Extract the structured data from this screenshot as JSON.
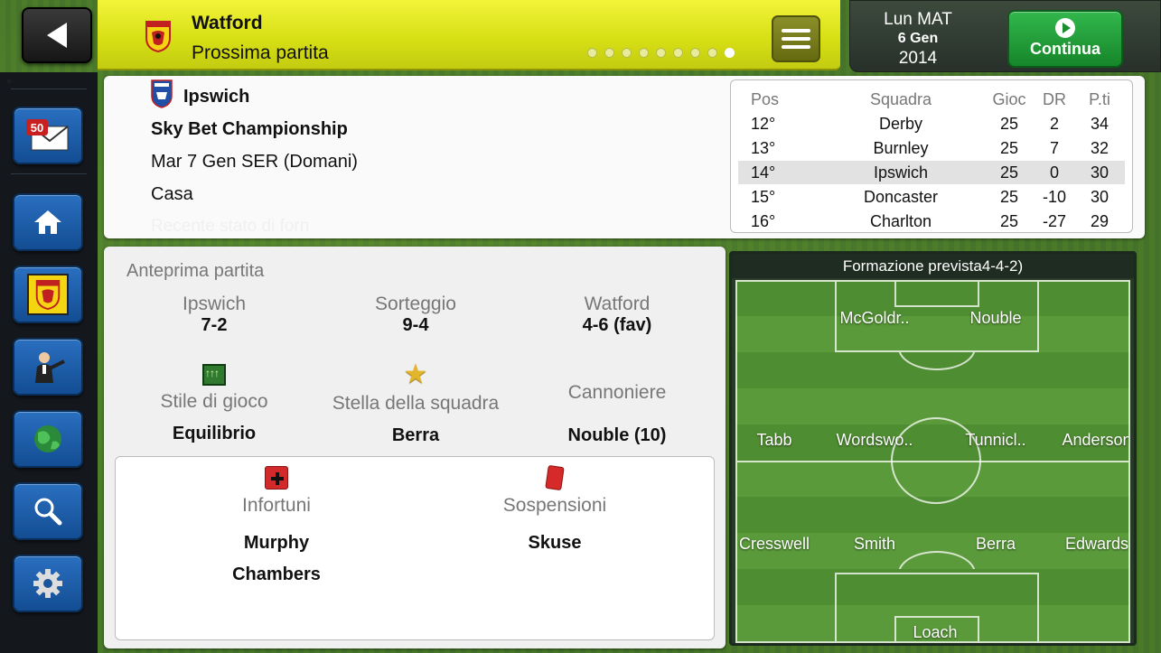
{
  "header": {
    "back_icon": "back-arrow-icon",
    "team_name": "Watford",
    "subtitle": "Prossima partita",
    "page_dots": 9,
    "active_dot": 8,
    "menu_icon": "hamburger-menu-icon"
  },
  "date": {
    "day": "Lun MAT",
    "date": "6 Gen",
    "year": "2014"
  },
  "continue": {
    "label": "Continua",
    "icon": "play-icon"
  },
  "sidebar": {
    "inbox_count": "50",
    "items": [
      {
        "name": "inbox",
        "icon": "mail-icon"
      },
      {
        "name": "home",
        "icon": "home-icon"
      },
      {
        "name": "club",
        "icon": "club-crest-icon"
      },
      {
        "name": "manager",
        "icon": "manager-icon"
      },
      {
        "name": "world",
        "icon": "globe-icon"
      },
      {
        "name": "search",
        "icon": "search-icon"
      },
      {
        "name": "settings",
        "icon": "gear-icon"
      }
    ]
  },
  "match": {
    "opponent": "Ipswich",
    "competition": "Sky Bet Championship",
    "date": "Mar 7 Gen SER (Domani)",
    "venue": "Casa",
    "form_label": "Recente stato di forn"
  },
  "table": {
    "headers": [
      "Pos",
      "Squadra",
      "Gioc",
      "DR",
      "P.ti"
    ],
    "rows": [
      {
        "pos": "12°",
        "team": "Derby",
        "played": "25",
        "gd": "2",
        "pts": "34"
      },
      {
        "pos": "13°",
        "team": "Burnley",
        "played": "25",
        "gd": "7",
        "pts": "32"
      },
      {
        "pos": "14°",
        "team": "Ipswich",
        "played": "25",
        "gd": "0",
        "pts": "30",
        "highlight": true
      },
      {
        "pos": "15°",
        "team": "Doncaster",
        "played": "25",
        "gd": "-10",
        "pts": "30"
      },
      {
        "pos": "16°",
        "team": "Charlton",
        "played": "25",
        "gd": "-27",
        "pts": "29"
      }
    ]
  },
  "preview": {
    "title": "Anteprima partita",
    "odds": [
      {
        "label": "Ipswich",
        "value": "7-2"
      },
      {
        "label": "Sorteggio",
        "value": "9-4"
      },
      {
        "label": "Watford",
        "value": "4-6 (fav)"
      }
    ],
    "stats": [
      {
        "label": "Stile di gioco",
        "value": "Equilibrio",
        "icon": "play-style-icon"
      },
      {
        "label": "Stella della squadra",
        "value": "Berra",
        "icon": "star-icon"
      },
      {
        "label": "Cannoniere",
        "value": "Nouble (10)"
      }
    ],
    "injuries": {
      "label": "Infortuni",
      "icon": "injury-icon",
      "players": [
        "Murphy",
        "Chambers"
      ]
    },
    "suspensions": {
      "label": "Sospensioni",
      "icon": "red-card-icon",
      "players": [
        "Skuse"
      ]
    }
  },
  "formation": {
    "title": "Formazione prevista4-4-2)",
    "forwards": [
      "McGoldr..",
      "Nouble"
    ],
    "midfielders": [
      "Tabb",
      "Wordswo..",
      "Tunnicl..",
      "Anderson"
    ],
    "defenders": [
      "Cresswell",
      "Smith",
      "Berra",
      "Edwards"
    ],
    "goalkeeper": "Loach"
  },
  "colors": {
    "header_yellow": "#d8e015",
    "button_blue": "#1f5fac",
    "continue_green": "#1a8e2f",
    "sidebar_dark": "#14181c"
  }
}
